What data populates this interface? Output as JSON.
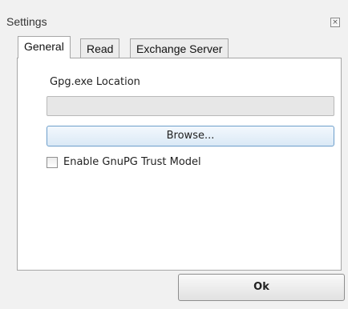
{
  "window": {
    "title": "Settings",
    "close_glyph": "×"
  },
  "tabs": [
    {
      "label": "General",
      "active": true
    },
    {
      "label": "Read",
      "active": false
    },
    {
      "label": "Exchange Server",
      "active": false
    }
  ],
  "general": {
    "location_label": "Gpg.exe Location",
    "location_value": "",
    "browse_label": "Browse...",
    "trust_model_label": "Enable GnuPG Trust Model",
    "trust_model_checked": false
  },
  "footer": {
    "ok_label": "Ok"
  },
  "colors": {
    "window_bg": "#f1f1f1",
    "panel_bg": "#ffffff",
    "browse_border": "#6d9ecb"
  }
}
